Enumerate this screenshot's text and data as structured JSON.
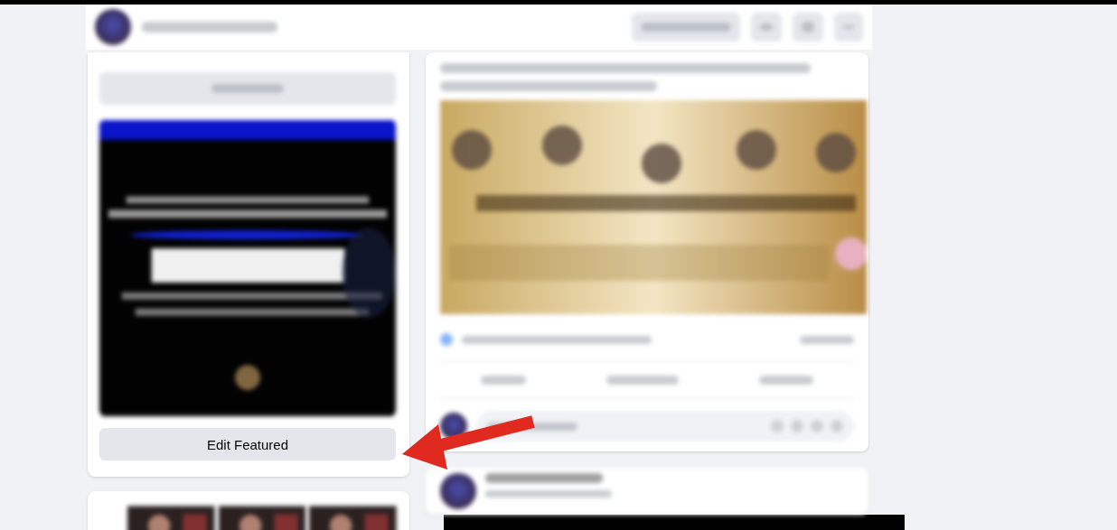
{
  "featured_section": {
    "edit_button": {
      "label": "Edit Featured"
    }
  }
}
